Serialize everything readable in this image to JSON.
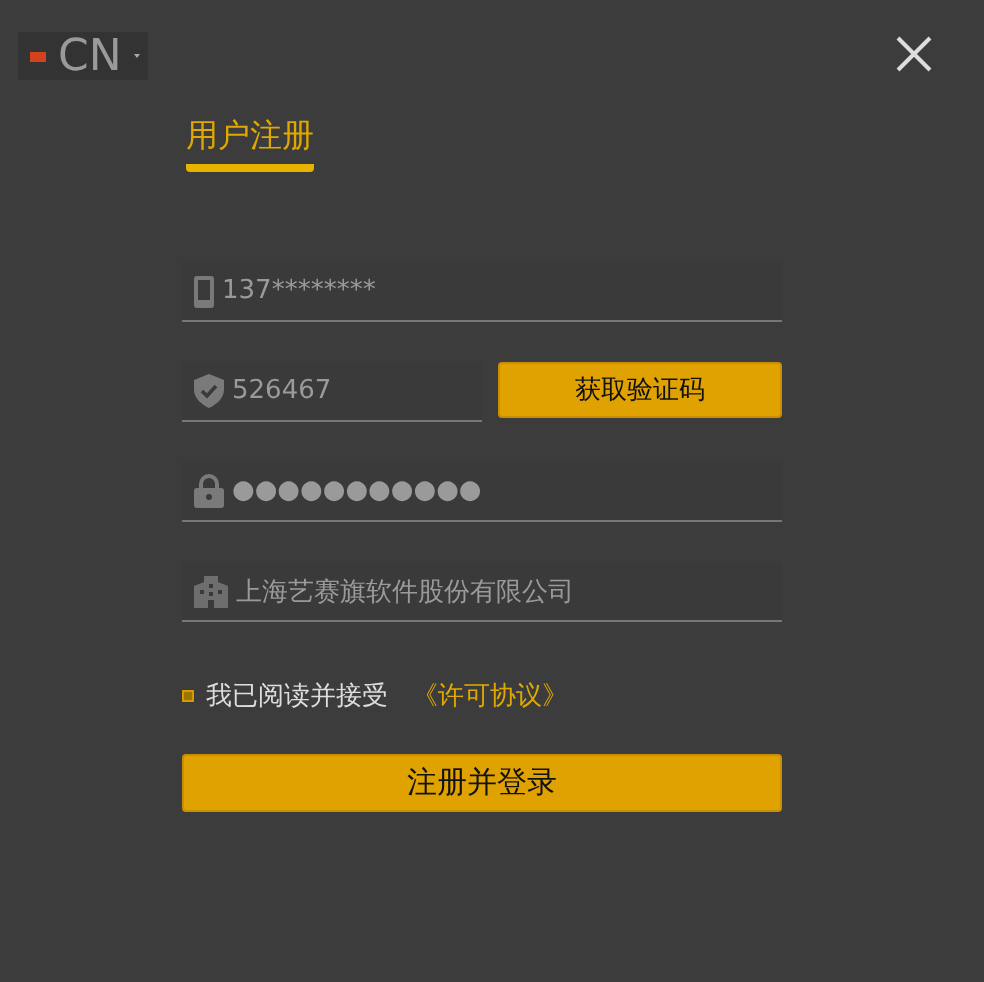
{
  "language": {
    "label": "CN"
  },
  "tabs": [
    {
      "label": "用户注册",
      "selected": true
    }
  ],
  "fields": [
    {
      "kind": "phone",
      "value": "137********"
    },
    {
      "kind": "code",
      "value": "526467",
      "button": "获取验证码"
    },
    {
      "kind": "password",
      "value": "●●●●●●●●●●●"
    },
    {
      "kind": "company",
      "value": "上海艺赛旗软件股份有限公司"
    }
  ],
  "agreement": {
    "checked": true,
    "text": "我已阅读并接受",
    "link": "《许可协议》"
  },
  "submit": "注册并登录"
}
